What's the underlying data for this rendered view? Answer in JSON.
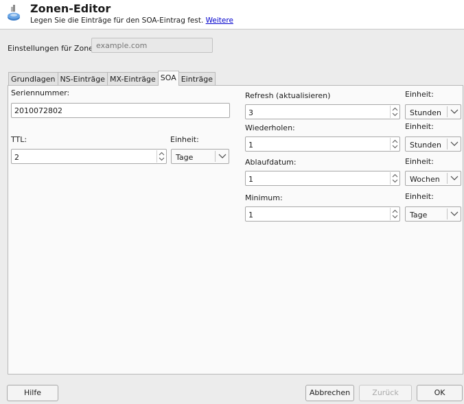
{
  "header": {
    "title": "Zonen-Editor",
    "subtitle": "Legen Sie die Einträge für den SOA-Eintrag fest.",
    "more_link": "Weitere",
    "icon": "network-computer-icon"
  },
  "zone": {
    "label": "Einstellungen für Zone",
    "placeholder": "example.com"
  },
  "tabs": [
    {
      "label": "Grundlagen",
      "active": false
    },
    {
      "label": "NS-Einträge",
      "active": false
    },
    {
      "label": "MX-Einträge",
      "active": false
    },
    {
      "label": "SOA",
      "active": true
    },
    {
      "label": "Einträge",
      "active": false
    }
  ],
  "soa": {
    "serial": {
      "label": "Seriennummer:",
      "value": "2010072802"
    },
    "ttl": {
      "label": "TTL:",
      "value": "2",
      "unit_label": "Einheit:",
      "unit": "Tage"
    },
    "refresh": {
      "label": "Refresh (aktualisieren)",
      "value": "3",
      "unit_label": "Einheit:",
      "unit": "Stunden"
    },
    "retry": {
      "label": "Wiederholen:",
      "value": "1",
      "unit_label": "Einheit:",
      "unit": "Stunden"
    },
    "expire": {
      "label": "Ablaufdatum:",
      "value": "1",
      "unit_label": "Einheit:",
      "unit": "Wochen"
    },
    "minimum": {
      "label": "Minimum:",
      "value": "1",
      "unit_label": "Einheit:",
      "unit": "Tage"
    }
  },
  "buttons": {
    "help": "Hilfe",
    "cancel": "Abbrechen",
    "back": "Zurück",
    "ok": "OK"
  }
}
